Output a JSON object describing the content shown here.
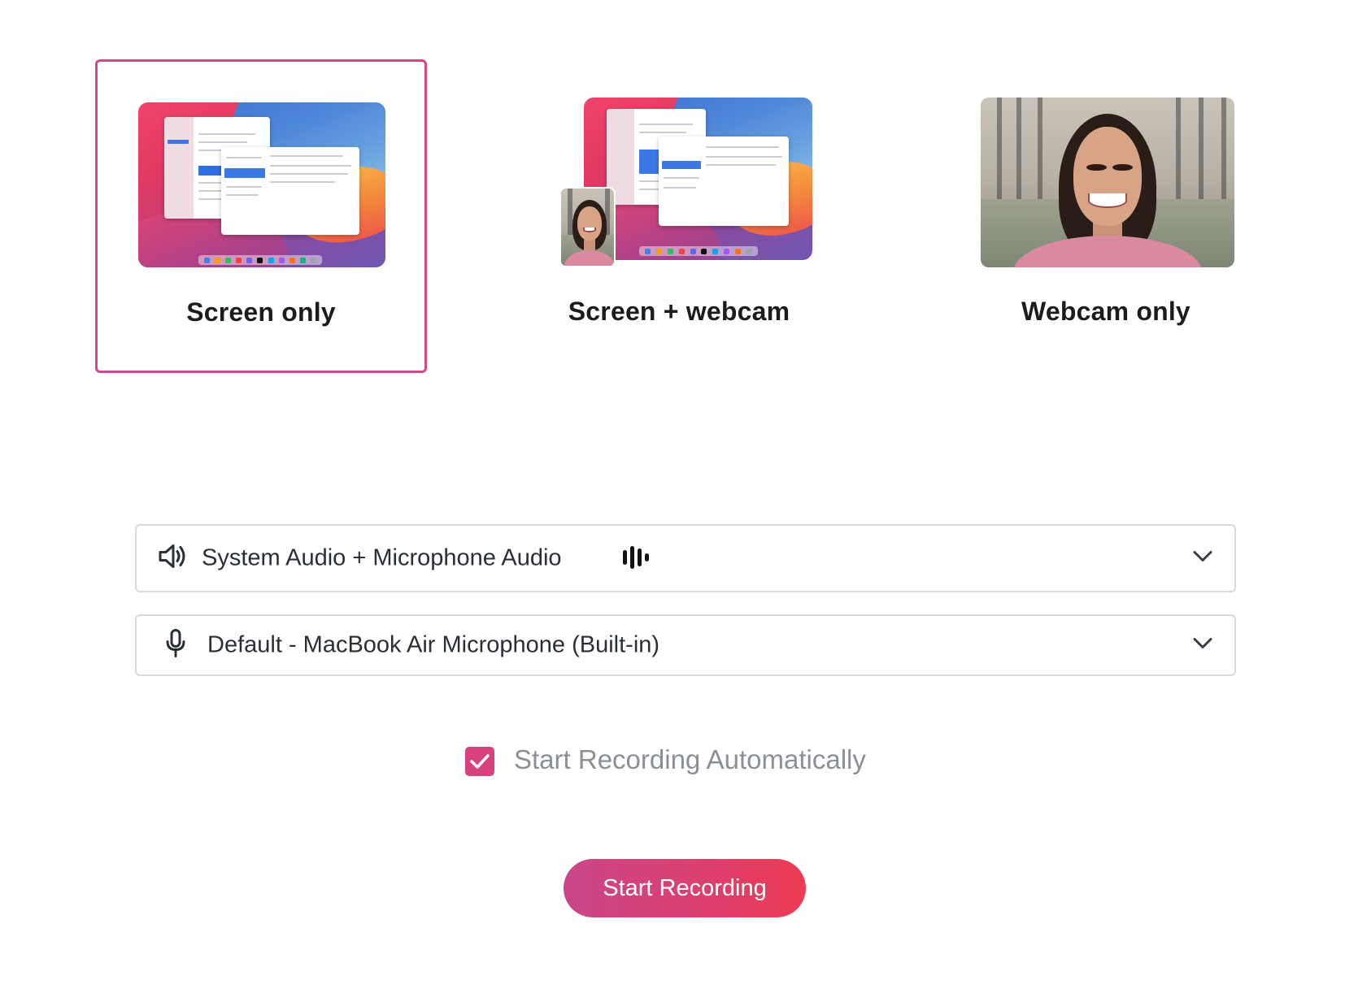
{
  "modes": [
    {
      "label": "Screen only",
      "selected": true
    },
    {
      "label": "Screen + webcam",
      "selected": false
    },
    {
      "label": "Webcam only",
      "selected": false
    }
  ],
  "audio_source": {
    "label": "System Audio + Microphone Audio",
    "icon": "speaker-icon"
  },
  "microphone": {
    "label": "Default - MacBook Air Microphone (Built-in)",
    "icon": "microphone-icon"
  },
  "auto_start": {
    "label": "Start Recording Automatically",
    "checked": true
  },
  "start_button": {
    "label": "Start Recording"
  },
  "colors": {
    "accent": "#d8407e",
    "button_gradient_start": "#c9468a",
    "button_gradient_end": "#ec3b52",
    "border": "#d9d9dc",
    "muted_text": "#8b8f96"
  }
}
